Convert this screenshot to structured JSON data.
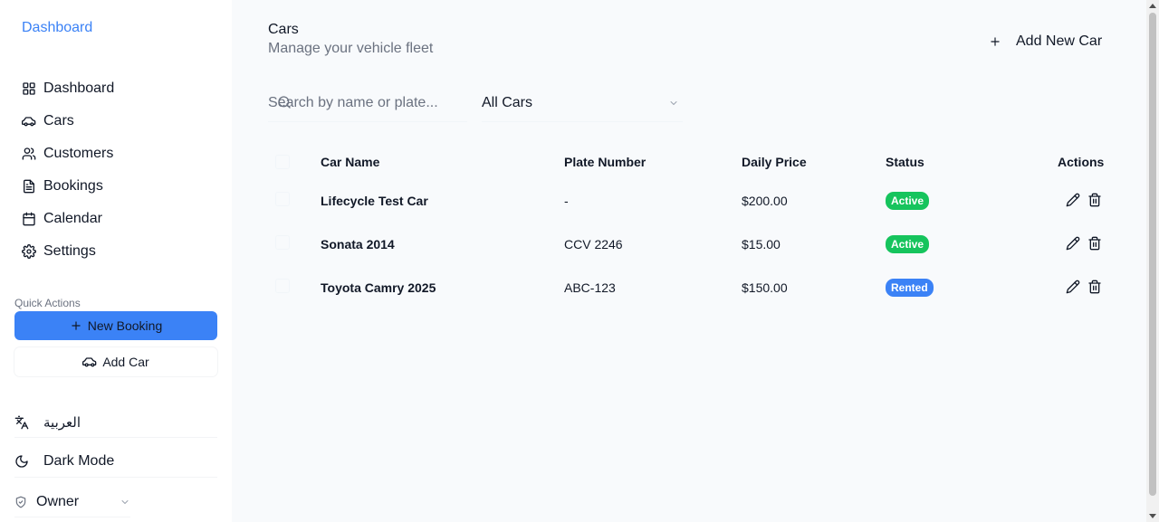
{
  "sidebar": {
    "brand": "Dashboard",
    "items": [
      {
        "label": "Dashboard",
        "icon": "grid-icon"
      },
      {
        "label": "Cars",
        "icon": "car-icon"
      },
      {
        "label": "Customers",
        "icon": "users-icon"
      },
      {
        "label": "Bookings",
        "icon": "file-icon"
      },
      {
        "label": "Calendar",
        "icon": "calendar-icon"
      },
      {
        "label": "Settings",
        "icon": "gear-icon"
      }
    ],
    "quick_actions_label": "Quick Actions",
    "new_booking_label": "New Booking",
    "add_car_label": "Add Car",
    "language_label": "العربية",
    "dark_mode_label": "Dark Mode",
    "role_label": "Owner"
  },
  "header": {
    "title": "Cars",
    "subtitle": "Manage your vehicle fleet",
    "add_button_label": "Add New Car"
  },
  "filters": {
    "search_placeholder": "Search by name or plate...",
    "search_value": "",
    "status_selected": "All Cars"
  },
  "table": {
    "columns": [
      "Car Name",
      "Plate Number",
      "Daily Price",
      "Status",
      "Actions"
    ],
    "rows": [
      {
        "name": "Lifecycle Test Car",
        "plate": "-",
        "price": "$200.00",
        "status": "Active"
      },
      {
        "name": "Sonata 2014",
        "plate": "CCV 2246",
        "price": "$15.00",
        "status": "Active"
      },
      {
        "name": "Toyota Camry 2025",
        "plate": "ABC-123",
        "price": "$150.00",
        "status": "Rented"
      }
    ]
  },
  "colors": {
    "accent": "#3b82f6",
    "active": "#16c45d",
    "rented": "#3b82f6"
  }
}
